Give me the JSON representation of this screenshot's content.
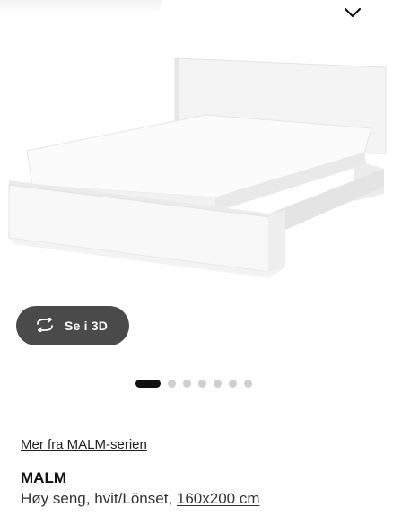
{
  "header": {
    "collapse_icon": "chevron-down-icon"
  },
  "gallery": {
    "view_3d_label": "Se i 3D",
    "view_3d_icon": "rotate-3d-icon",
    "total_images": 7,
    "active_index": 0
  },
  "product": {
    "series_link": "Mer fra MALM-serien",
    "name": "MALM",
    "description": "Høy seng, hvit/Lönset, ",
    "size": "160x200 cm"
  },
  "colors": {
    "button_bg": "#4a4a4a",
    "dot_active": "#111111",
    "dot_inactive": "#cfcfcf"
  }
}
